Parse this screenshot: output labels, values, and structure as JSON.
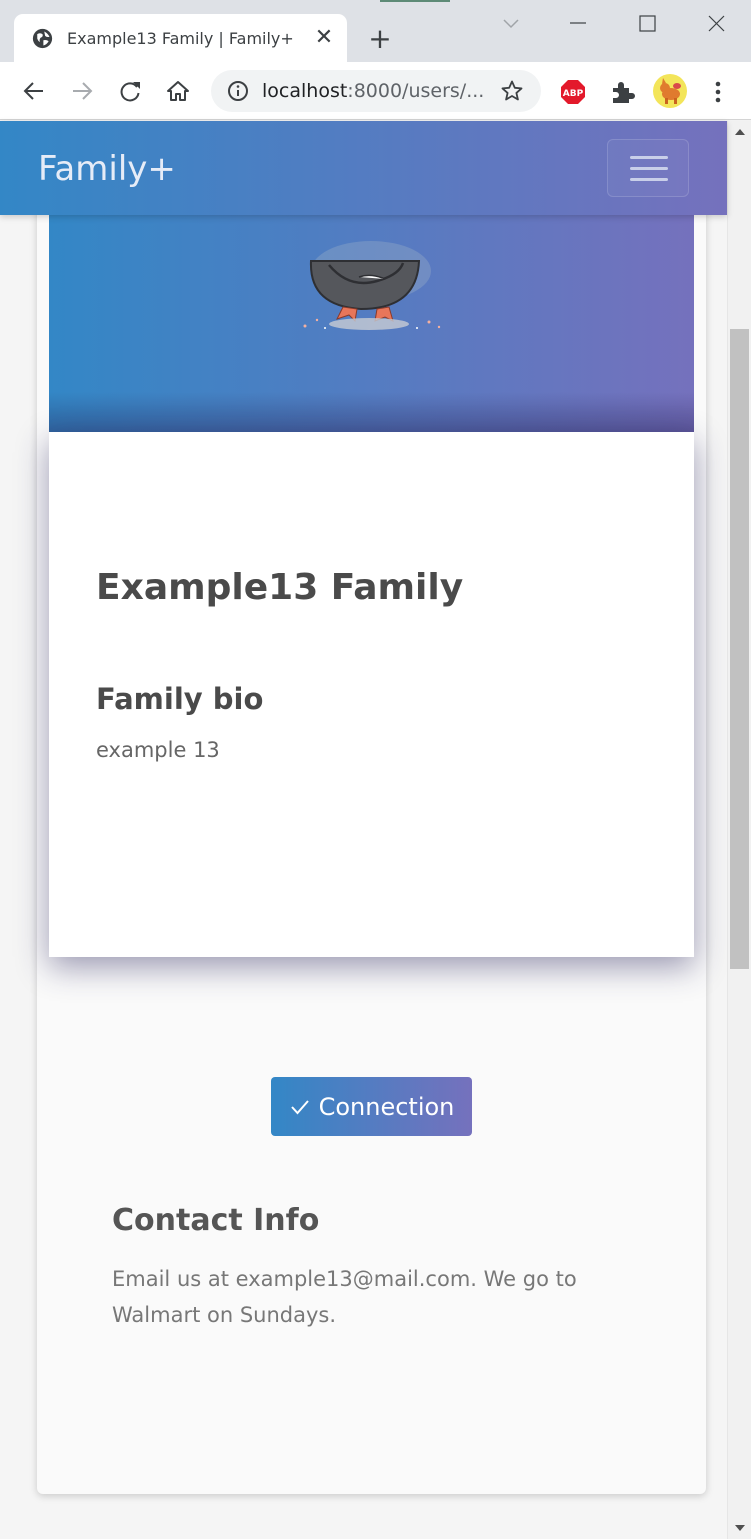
{
  "browser": {
    "tab_title": "Example13 Family | Family+",
    "url_host": "localhost",
    "url_rest": ":8000/users/..."
  },
  "navbar": {
    "brand": "Family+"
  },
  "family": {
    "name": "Example13 Family",
    "bio_heading": "Family bio",
    "bio_text": "example 13"
  },
  "connection_button": {
    "label": "Connection"
  },
  "contact": {
    "heading": "Contact Info",
    "text": "Email us at example13@mail.com. We go to Walmart on Sundays."
  },
  "colors": {
    "gradient_start": "#3387c6",
    "gradient_end": "#7571bd"
  },
  "icons": [
    "globe-icon",
    "close-icon",
    "plus-icon",
    "chevron-down-icon",
    "minimize-icon",
    "maximize-icon",
    "back-icon",
    "forward-icon",
    "reload-icon",
    "home-icon",
    "info-icon",
    "star-icon",
    "adblock-icon",
    "puzzle-icon",
    "profile-icon",
    "kebab-menu-icon",
    "hamburger-icon",
    "check-icon"
  ]
}
